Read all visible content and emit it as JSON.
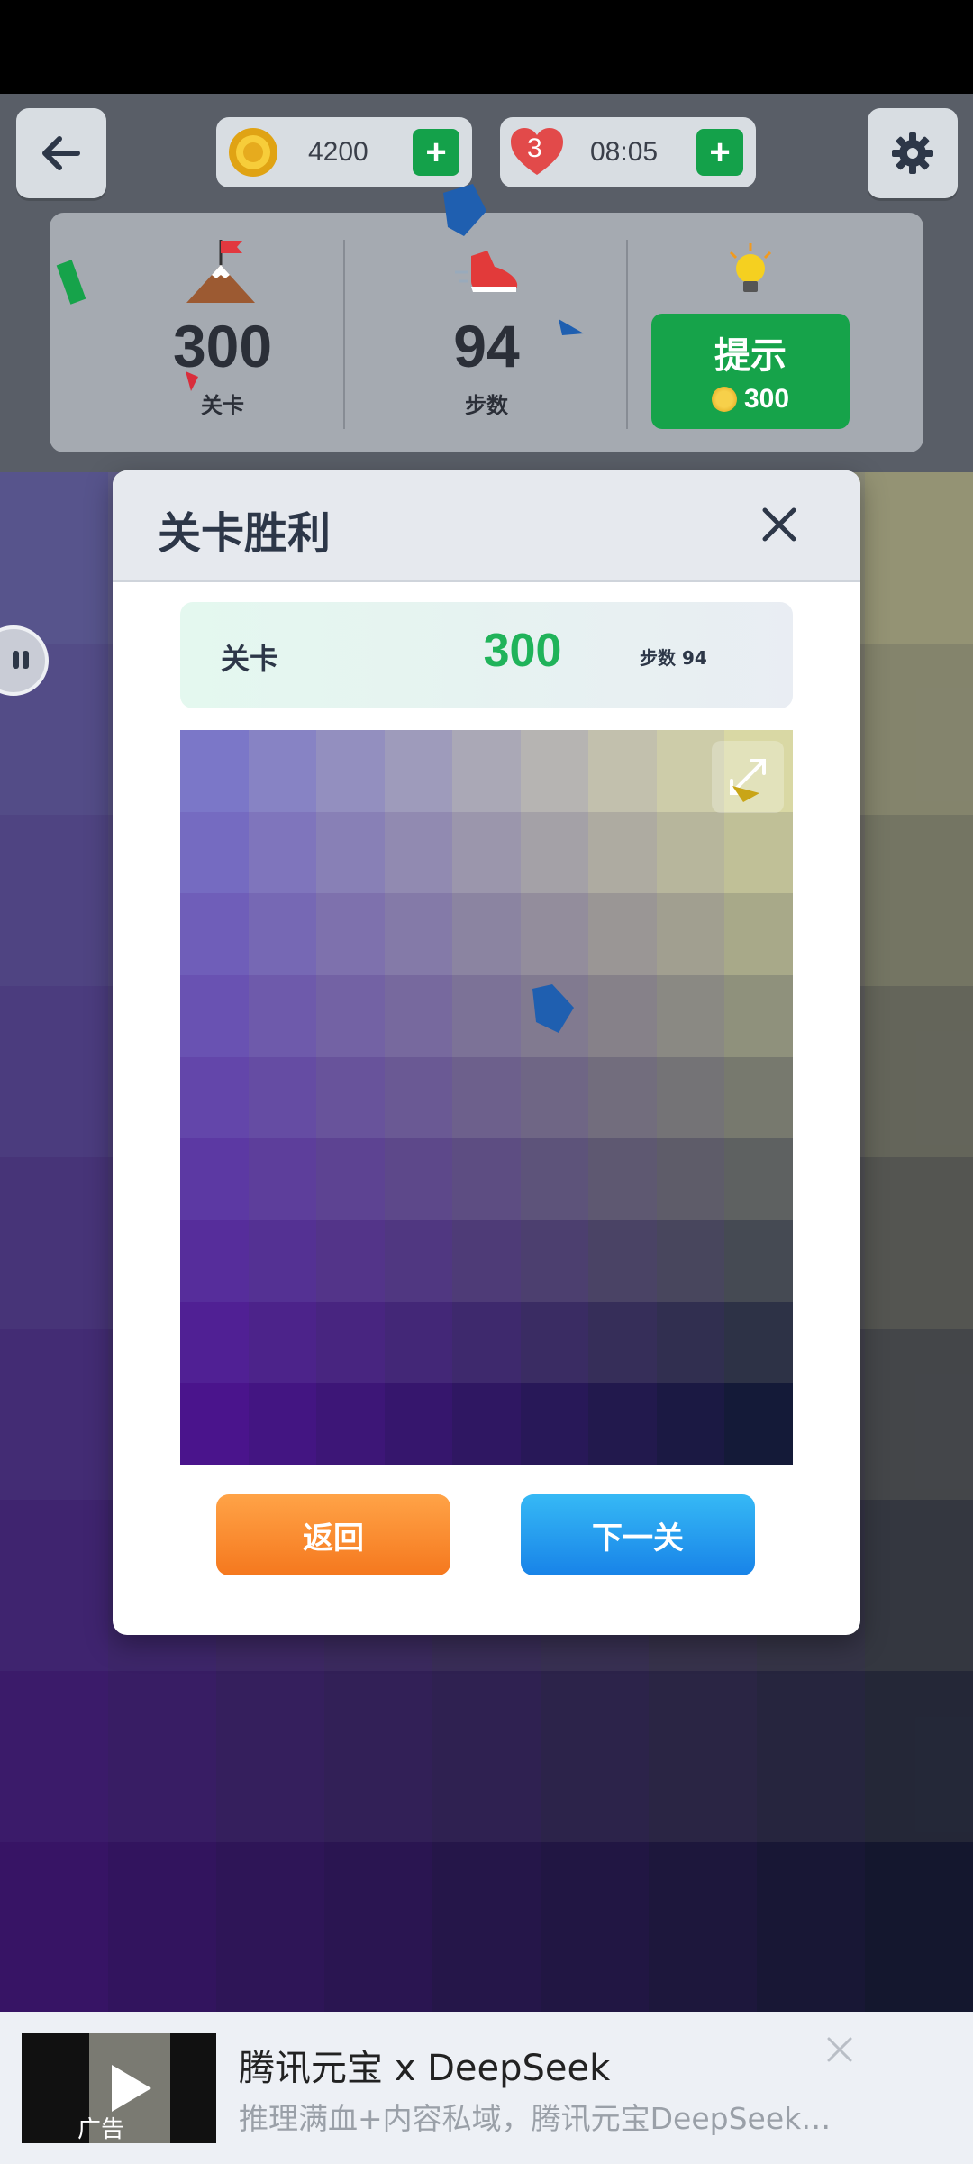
{
  "hud": {
    "coins": "4200",
    "lives": "3",
    "timer": "08:05"
  },
  "stats": {
    "level_value": "300",
    "level_label": "关卡",
    "steps_value": "94",
    "steps_label": "步数",
    "hint_label": "提示",
    "hint_cost": "300"
  },
  "modal": {
    "title": "关卡胜利",
    "level_label": "关卡",
    "level_value": "300",
    "steps_text": "步数 94",
    "back_label": "返回",
    "next_label": "下一关"
  },
  "ad": {
    "title": "腾讯元宝 x DeepSeek",
    "subtitle": "推理满血+内容私域，腾讯元宝DeepSeek…",
    "tag": "广告"
  },
  "colors": {
    "accent_green": "#16a34a",
    "level_green": "#20b35a",
    "back_orange": "#f5781e",
    "next_blue": "#1883e8",
    "palette_top_left": "#7b77c8",
    "palette_top_right": "#d9d8a4",
    "palette_bottom_left": "#4a148c",
    "palette_bottom_right": "#141a38"
  },
  "icons": {
    "back": "arrow-left-icon",
    "coin": "coin-icon",
    "heart": "heart-icon",
    "settings": "gear-icon",
    "level": "mountain-flag-icon",
    "steps": "shoe-icon",
    "hint": "lightbulb-icon",
    "close": "close-icon",
    "expand": "expand-icon",
    "play": "play-icon"
  }
}
